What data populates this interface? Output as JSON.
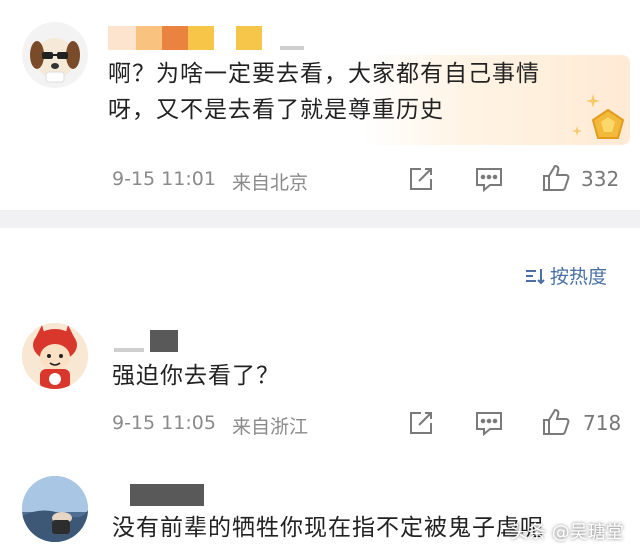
{
  "comments": [
    {
      "text_line1": "啊？为啥一定要去看，大家都有自己事情",
      "text_line2": "呀，又不是去看了就是尊重历史",
      "time": "9-15 11:01",
      "location": "来自北京",
      "likes": "332",
      "avatar_icon": "beagle-dog-avatar",
      "name_colors": [
        "#fde4cf",
        "#f9c27f",
        "#e9833f",
        "#f7c548",
        "#ffffff",
        "#f5c64a"
      ]
    },
    {
      "text": "强迫你去看了？",
      "time": "9-15 11:05",
      "location": "来自浙江",
      "likes": "718",
      "avatar_icon": "cartoon-child-avatar"
    },
    {
      "text": "没有前辈的牺牲你现在指不定被鬼子虐呢",
      "avatar_icon": "landscape-photo-avatar"
    }
  ],
  "sort": {
    "label": "按热度"
  },
  "watermark": {
    "text": "头条 @吴瑭堂"
  },
  "colors": {
    "accent": "#4a6fa5",
    "meta": "#8a8a8a",
    "band": "#f1f1f3"
  }
}
